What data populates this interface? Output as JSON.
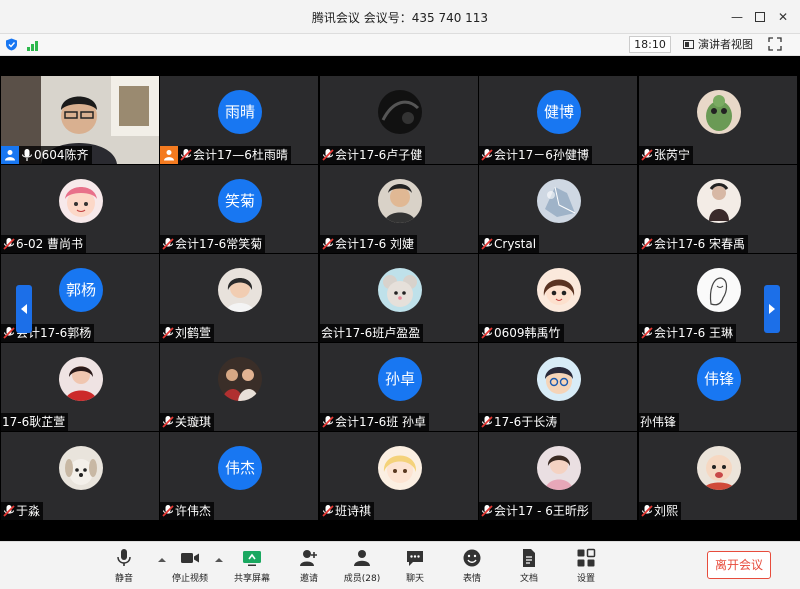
{
  "window": {
    "title": "腾讯会议 会议号：435 740 113"
  },
  "topbar": {
    "time": "18:10",
    "speaker_view": "演讲者视图"
  },
  "participants": [
    {
      "name": "0604陈齐",
      "avatar": "video",
      "mic": "on",
      "host": "blue"
    },
    {
      "name": "会计17—6杜雨晴",
      "avatar": "text",
      "avatar_text": "雨晴",
      "mic": "muted",
      "host": "orange"
    },
    {
      "name": "会计17-6卢子健",
      "avatar": "photo",
      "photo": "dark-icon",
      "mic": "muted"
    },
    {
      "name": "会计17－6孙健博",
      "avatar": "text",
      "avatar_text": "健博",
      "mic": "muted"
    },
    {
      "name": "张芮宁",
      "avatar": "photo",
      "photo": "green-creature-icon",
      "mic": "muted"
    },
    {
      "name": "6-02 曹尚书",
      "avatar": "photo",
      "photo": "cartoon-girl-icon",
      "mic": "muted"
    },
    {
      "name": "会计17-6常笑菊",
      "avatar": "text",
      "avatar_text": "笑菊",
      "mic": "muted"
    },
    {
      "name": "会计17-6 刘婕",
      "avatar": "photo",
      "photo": "portrait-icon",
      "mic": "muted"
    },
    {
      "name": "Crystal",
      "avatar": "photo",
      "photo": "crystal-icon",
      "mic": "muted"
    },
    {
      "name": "会计17-6 宋春禹",
      "avatar": "photo",
      "photo": "figure-icon",
      "mic": "muted"
    },
    {
      "name": "会计17-6郭杨",
      "avatar": "text",
      "avatar_text": "郭杨",
      "mic": "muted"
    },
    {
      "name": "刘鹤萱",
      "avatar": "photo",
      "photo": "girl-photo-icon",
      "mic": "muted"
    },
    {
      "name": "会计17-6班卢盈盈",
      "avatar": "photo",
      "photo": "mouse-cartoon-icon",
      "mic": "none"
    },
    {
      "name": "0609韩禹竹",
      "avatar": "photo",
      "photo": "anime-girl-icon",
      "mic": "muted"
    },
    {
      "name": "会计17-6 王琳",
      "avatar": "photo",
      "photo": "sketch-icon",
      "mic": "muted"
    },
    {
      "name": "17-6耿芷萱",
      "avatar": "photo",
      "photo": "red-girl-icon",
      "mic": "none"
    },
    {
      "name": "关璇琪",
      "avatar": "photo",
      "photo": "group-photo-icon",
      "mic": "muted"
    },
    {
      "name": "会计17-6班 孙卓",
      "avatar": "text",
      "avatar_text": "孙卓",
      "mic": "muted"
    },
    {
      "name": "17-6于长涛",
      "avatar": "photo",
      "photo": "cartoon-boy-icon",
      "mic": "muted"
    },
    {
      "name": "孙伟锋",
      "avatar": "text",
      "avatar_text": "伟锋",
      "mic": "none"
    },
    {
      "name": "于淼",
      "avatar": "photo",
      "photo": "dog-icon",
      "mic": "muted"
    },
    {
      "name": "许伟杰",
      "avatar": "text",
      "avatar_text": "伟杰",
      "mic": "muted"
    },
    {
      "name": "班诗祺",
      "avatar": "photo",
      "photo": "blonde-cartoon-icon",
      "mic": "muted"
    },
    {
      "name": "会计17 - 6王昕彤",
      "avatar": "photo",
      "photo": "pink-girl-icon",
      "mic": "muted"
    },
    {
      "name": "刘熙",
      "avatar": "photo",
      "photo": "baby-icon",
      "mic": "muted"
    }
  ],
  "toolbar": {
    "mute": "静音",
    "stop_video": "停止视频",
    "share_screen": "共享屏幕",
    "invite": "邀请",
    "members": "成员(28)",
    "chat": "聊天",
    "reactions": "表情",
    "documents": "文档",
    "settings": "设置",
    "leave": "离开会议"
  },
  "colors": {
    "accent": "#1877f2",
    "host_orange": "#f47b20",
    "leave_red": "#e74c3c",
    "tile_bg": "#2b2b2d"
  }
}
